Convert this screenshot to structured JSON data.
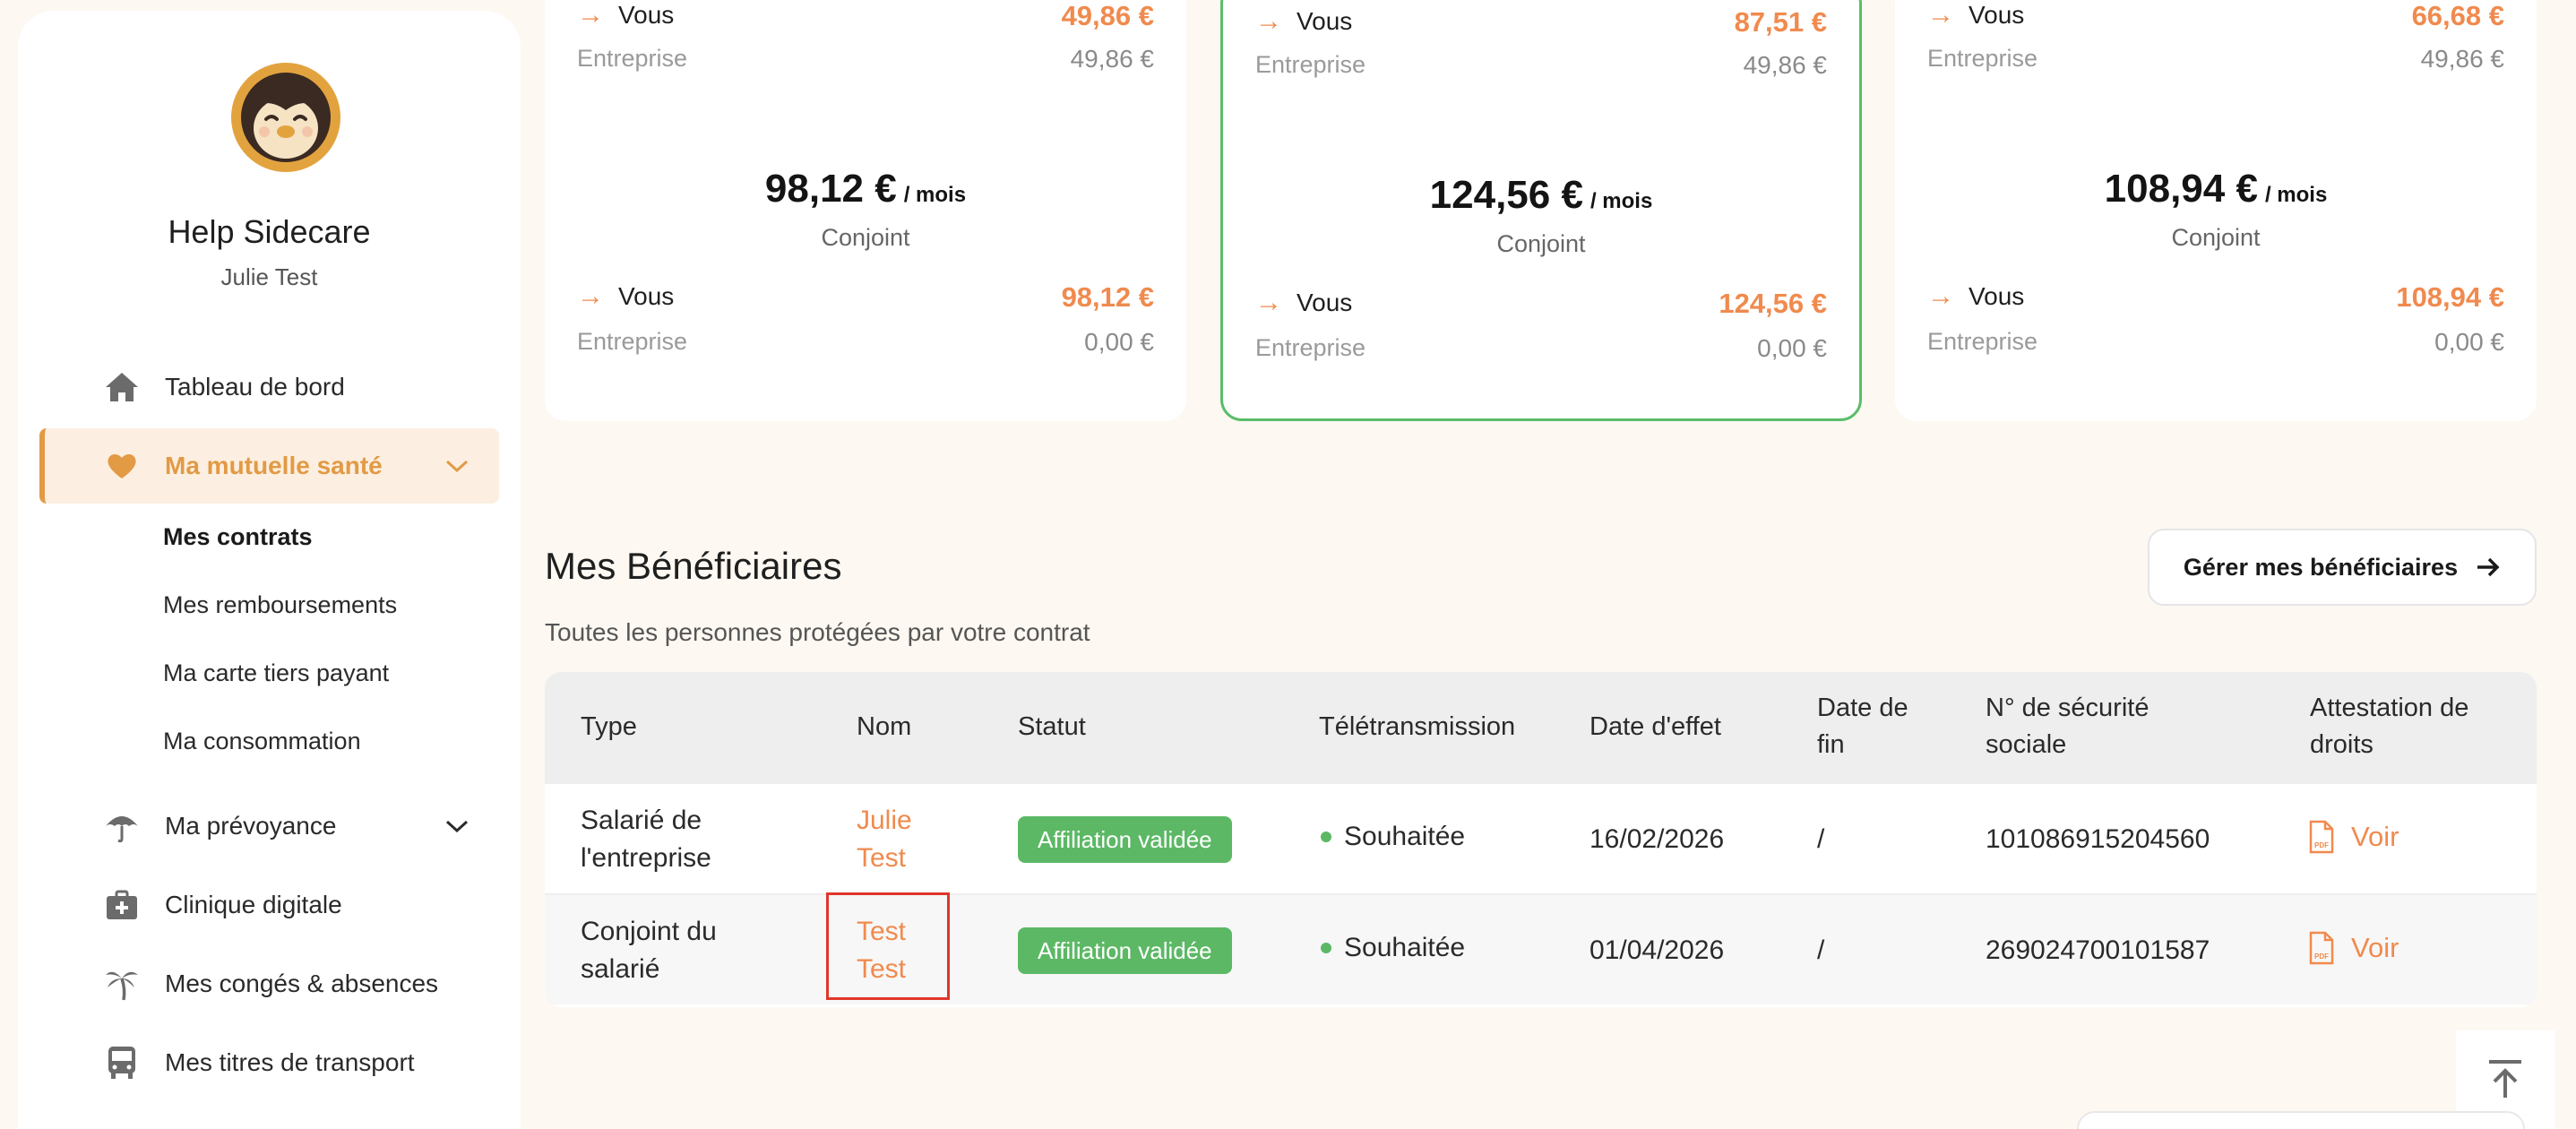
{
  "profile": {
    "name": "Help Sidecare",
    "user": "Julie Test"
  },
  "nav": {
    "dashboard": "Tableau de bord",
    "health": "Ma mutuelle santé",
    "health_sub": [
      "Mes contrats",
      "Mes remboursements",
      "Ma carte tiers payant",
      "Ma consommation"
    ],
    "prevoyance": "Ma prévoyance",
    "clinic": "Clinique digitale",
    "leave": "Mes congés & absences",
    "transport": "Mes titres de transport"
  },
  "cards": [
    {
      "top_vous": "49,86 €",
      "top_entreprise": "49,86 €",
      "total": "98,12 €",
      "per": "/ mois",
      "label": "Conjoint",
      "bot_vous": "98,12 €",
      "bot_entreprise": "0,00 €",
      "selected": false
    },
    {
      "top_vous": "87,51 €",
      "top_entreprise": "49,86 €",
      "total": "124,56 €",
      "per": "/ mois",
      "label": "Conjoint",
      "bot_vous": "124,56 €",
      "bot_entreprise": "0,00 €",
      "selected": true
    },
    {
      "top_vous": "66,68 €",
      "top_entreprise": "49,86 €",
      "total": "108,94 €",
      "per": "/ mois",
      "label": "Conjoint",
      "bot_vous": "108,94 €",
      "bot_entreprise": "0,00 €",
      "selected": false
    }
  ],
  "card_labels": {
    "vous": "Vous",
    "entreprise": "Entreprise"
  },
  "beneficiaries": {
    "title": "Mes Bénéficiaires",
    "subtitle": "Toutes les personnes protégées par votre contrat",
    "manage_button": "Gérer mes bénéficiaires",
    "columns": [
      "Type",
      "Nom",
      "Statut",
      "Télétransmission",
      "Date d'effet",
      "Date de fin",
      "N° de sécurité sociale",
      "Attestation de droits"
    ],
    "rows": [
      {
        "type": "Salarié de l'entreprise",
        "name": "Julie Test",
        "status": "Affiliation validée",
        "teletrans": "Souhaitée",
        "date_effet": "16/02/2026",
        "date_fin": "/",
        "ssn": "101086915204560",
        "attestation": "Voir"
      },
      {
        "type": "Conjoint du salarié",
        "name": "Test Test",
        "status": "Affiliation validée",
        "teletrans": "Souhaitée",
        "date_effet": "01/04/2026",
        "date_fin": "/",
        "ssn": "269024700101587",
        "attestation": "Voir"
      }
    ]
  },
  "colors": {
    "accent": "#f08a4e",
    "nav_active": "#e29a45",
    "success": "#5cb865",
    "background": "#fdf8f2"
  }
}
